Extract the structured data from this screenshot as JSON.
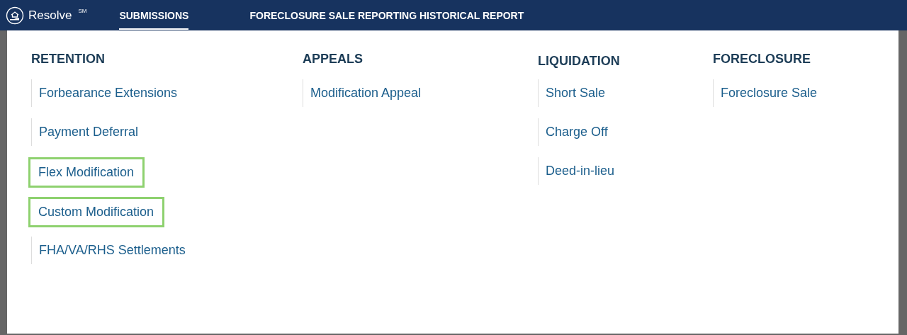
{
  "header": {
    "brand": "Resolve",
    "brand_mark": "SM",
    "tabs": [
      {
        "label": "SUBMISSIONS",
        "selected": true
      },
      {
        "label": "FORECLOSURE SALE REPORTING HISTORICAL REPORT",
        "selected": false
      }
    ]
  },
  "menu": {
    "columns": [
      {
        "heading": "RETENTION",
        "items": [
          {
            "label": "Forbearance Extensions",
            "highlighted": false
          },
          {
            "label": "Payment Deferral",
            "highlighted": false
          },
          {
            "label": "Flex Modification",
            "highlighted": true
          },
          {
            "label": "Custom Modification",
            "highlighted": true
          },
          {
            "label": "FHA/VA/RHS Settlements",
            "highlighted": false
          }
        ]
      },
      {
        "heading": "APPEALS",
        "items": [
          {
            "label": "Modification Appeal",
            "highlighted": false
          }
        ]
      },
      {
        "heading": "LIQUIDATION",
        "items": [
          {
            "label": "Short Sale",
            "highlighted": false
          },
          {
            "label": "Charge Off",
            "highlighted": false
          },
          {
            "label": "Deed-in-lieu",
            "highlighted": false
          }
        ]
      },
      {
        "heading": "FORECLOSURE",
        "items": [
          {
            "label": "Foreclosure Sale",
            "highlighted": false
          }
        ]
      }
    ]
  }
}
